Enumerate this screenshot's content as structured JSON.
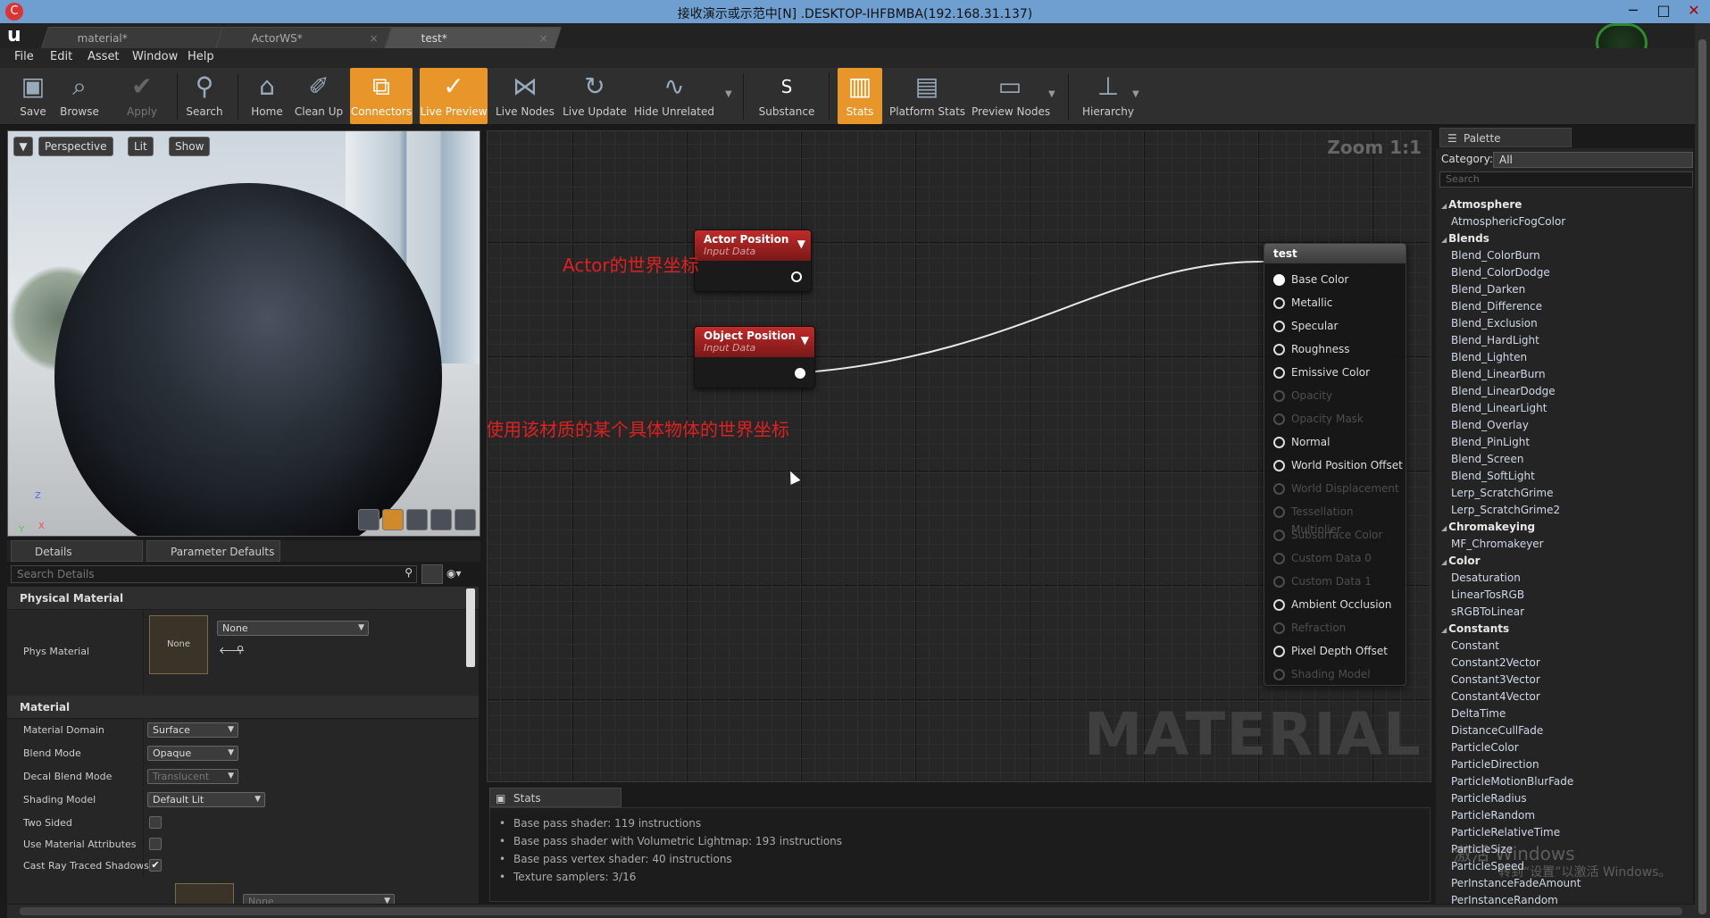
{
  "window": {
    "title": "接收演示或示范中[N] .DESKTOP-IHFBMBA(192.168.31.137)"
  },
  "tabs": [
    {
      "label": "material*"
    },
    {
      "label": "ActorWS*"
    },
    {
      "label": "test*"
    }
  ],
  "menu": [
    "File",
    "Edit",
    "Asset",
    "Window",
    "Help"
  ],
  "toolbar": [
    {
      "label": "Save",
      "icon": "save-icon"
    },
    {
      "label": "Browse",
      "icon": "browse-icon"
    },
    {
      "label": "Apply",
      "icon": "apply-icon"
    },
    {
      "label": "Search",
      "icon": "search-icon"
    },
    {
      "label": "Home",
      "icon": "home-icon"
    },
    {
      "label": "Clean Up",
      "icon": "broom-icon"
    },
    {
      "label": "Connectors",
      "icon": "connectors-icon"
    },
    {
      "label": "Live Preview",
      "icon": "live-preview-icon"
    },
    {
      "label": "Live Nodes",
      "icon": "live-nodes-icon"
    },
    {
      "label": "Live Update",
      "icon": "live-update-icon"
    },
    {
      "label": "Hide Unrelated",
      "icon": "hide-unrelated-icon"
    },
    {
      "label": "Substance",
      "icon": "substance-icon"
    },
    {
      "label": "Stats",
      "icon": "stats-icon"
    },
    {
      "label": "Platform Stats",
      "icon": "platform-stats-icon"
    },
    {
      "label": "Preview Nodes",
      "icon": "preview-nodes-icon"
    },
    {
      "label": "Hierarchy",
      "icon": "hierarchy-icon"
    }
  ],
  "viewport": {
    "perspective": "Perspective",
    "lit": "Lit",
    "show": "Show",
    "axis_z": "Z",
    "axis_x": "X",
    "axis_y": "Y"
  },
  "details": {
    "tab_details": "Details",
    "tab_params": "Parameter Defaults",
    "search_placeholder": "Search Details",
    "cat_physical": "Physical Material",
    "phys_material_label": "Phys Material",
    "phys_thumb": "None",
    "phys_value": "None",
    "cat_material": "Material",
    "rows": [
      {
        "label": "Material Domain",
        "value": "Surface"
      },
      {
        "label": "Blend Mode",
        "value": "Opaque"
      },
      {
        "label": "Decal Blend Mode",
        "value": "Translucent"
      },
      {
        "label": "Shading Model",
        "value": "Default Lit"
      }
    ],
    "two_sided": "Two Sided",
    "use_attr": "Use Material Attributes",
    "cast_ray": "Cast Ray Traced Shadows",
    "bottom_none": "None"
  },
  "graph": {
    "zoom": "Zoom 1:1",
    "watermark": "MATERIAL",
    "node_actor": {
      "title": "Actor Position",
      "subtitle": "Input Data"
    },
    "node_object": {
      "title": "Object Position",
      "subtitle": "Input Data"
    },
    "annotation_actor": "Actor的世界坐标",
    "annotation_object": "蓝图中某个使用该材质的某个具体物体的世界坐标",
    "result_node": {
      "title": "test",
      "pins": [
        {
          "label": "Base Color",
          "state": "connected"
        },
        {
          "label": "Metallic",
          "state": "enabled"
        },
        {
          "label": "Specular",
          "state": "enabled"
        },
        {
          "label": "Roughness",
          "state": "enabled"
        },
        {
          "label": "Emissive Color",
          "state": "enabled"
        },
        {
          "label": "Opacity",
          "state": "disabled"
        },
        {
          "label": "Opacity Mask",
          "state": "disabled"
        },
        {
          "label": "Normal",
          "state": "enabled"
        },
        {
          "label": "World Position Offset",
          "state": "enabled"
        },
        {
          "label": "World Displacement",
          "state": "disabled"
        },
        {
          "label": "Tessellation Multiplier",
          "state": "disabled"
        },
        {
          "label": "Subsurface Color",
          "state": "disabled"
        },
        {
          "label": "Custom Data 0",
          "state": "disabled"
        },
        {
          "label": "Custom Data 1",
          "state": "disabled"
        },
        {
          "label": "Ambient Occlusion",
          "state": "enabled"
        },
        {
          "label": "Refraction",
          "state": "disabled"
        },
        {
          "label": "Pixel Depth Offset",
          "state": "enabled"
        },
        {
          "label": "Shading Model",
          "state": "disabled"
        }
      ]
    }
  },
  "stats": {
    "tab": "Stats",
    "lines": [
      "Base pass shader: 119 instructions",
      "Base pass shader with Volumetric Lightmap: 193 instructions",
      "Base pass vertex shader: 40 instructions",
      "Texture samplers: 3/16"
    ]
  },
  "palette": {
    "tab": "Palette",
    "category_label": "Category:",
    "category_value": "All",
    "search_placeholder": "Search",
    "items": [
      {
        "label": "Atmosphere",
        "cat": true
      },
      {
        "label": "AtmosphericFogColor"
      },
      {
        "label": "Blends",
        "cat": true
      },
      {
        "label": "Blend_ColorBurn"
      },
      {
        "label": "Blend_ColorDodge"
      },
      {
        "label": "Blend_Darken"
      },
      {
        "label": "Blend_Difference"
      },
      {
        "label": "Blend_Exclusion"
      },
      {
        "label": "Blend_HardLight"
      },
      {
        "label": "Blend_Lighten"
      },
      {
        "label": "Blend_LinearBurn"
      },
      {
        "label": "Blend_LinearDodge"
      },
      {
        "label": "Blend_LinearLight"
      },
      {
        "label": "Blend_Overlay"
      },
      {
        "label": "Blend_PinLight"
      },
      {
        "label": "Blend_Screen"
      },
      {
        "label": "Blend_SoftLight"
      },
      {
        "label": "Lerp_ScratchGrime"
      },
      {
        "label": "Lerp_ScratchGrime2"
      },
      {
        "label": "Chromakeying",
        "cat": true
      },
      {
        "label": "MF_Chromakeyer"
      },
      {
        "label": "Color",
        "cat": true
      },
      {
        "label": "Desaturation"
      },
      {
        "label": "LinearTosRGB"
      },
      {
        "label": "sRGBToLinear"
      },
      {
        "label": "Constants",
        "cat": true
      },
      {
        "label": "Constant"
      },
      {
        "label": "Constant2Vector"
      },
      {
        "label": "Constant3Vector"
      },
      {
        "label": "Constant4Vector"
      },
      {
        "label": "DeltaTime"
      },
      {
        "label": "DistanceCullFade"
      },
      {
        "label": "ParticleColor"
      },
      {
        "label": "ParticleDirection"
      },
      {
        "label": "ParticleMotionBlurFade"
      },
      {
        "label": "ParticleRadius"
      },
      {
        "label": "ParticleRandom"
      },
      {
        "label": "ParticleRelativeTime"
      },
      {
        "label": "ParticleSize"
      },
      {
        "label": "ParticleSpeed"
      },
      {
        "label": "PerInstanceFadeAmount"
      },
      {
        "label": "PerInstanceRandom"
      }
    ]
  },
  "os_watermark": {
    "line1": "激活 Windows",
    "line2": "转到“设置”以激活 Windows。"
  }
}
